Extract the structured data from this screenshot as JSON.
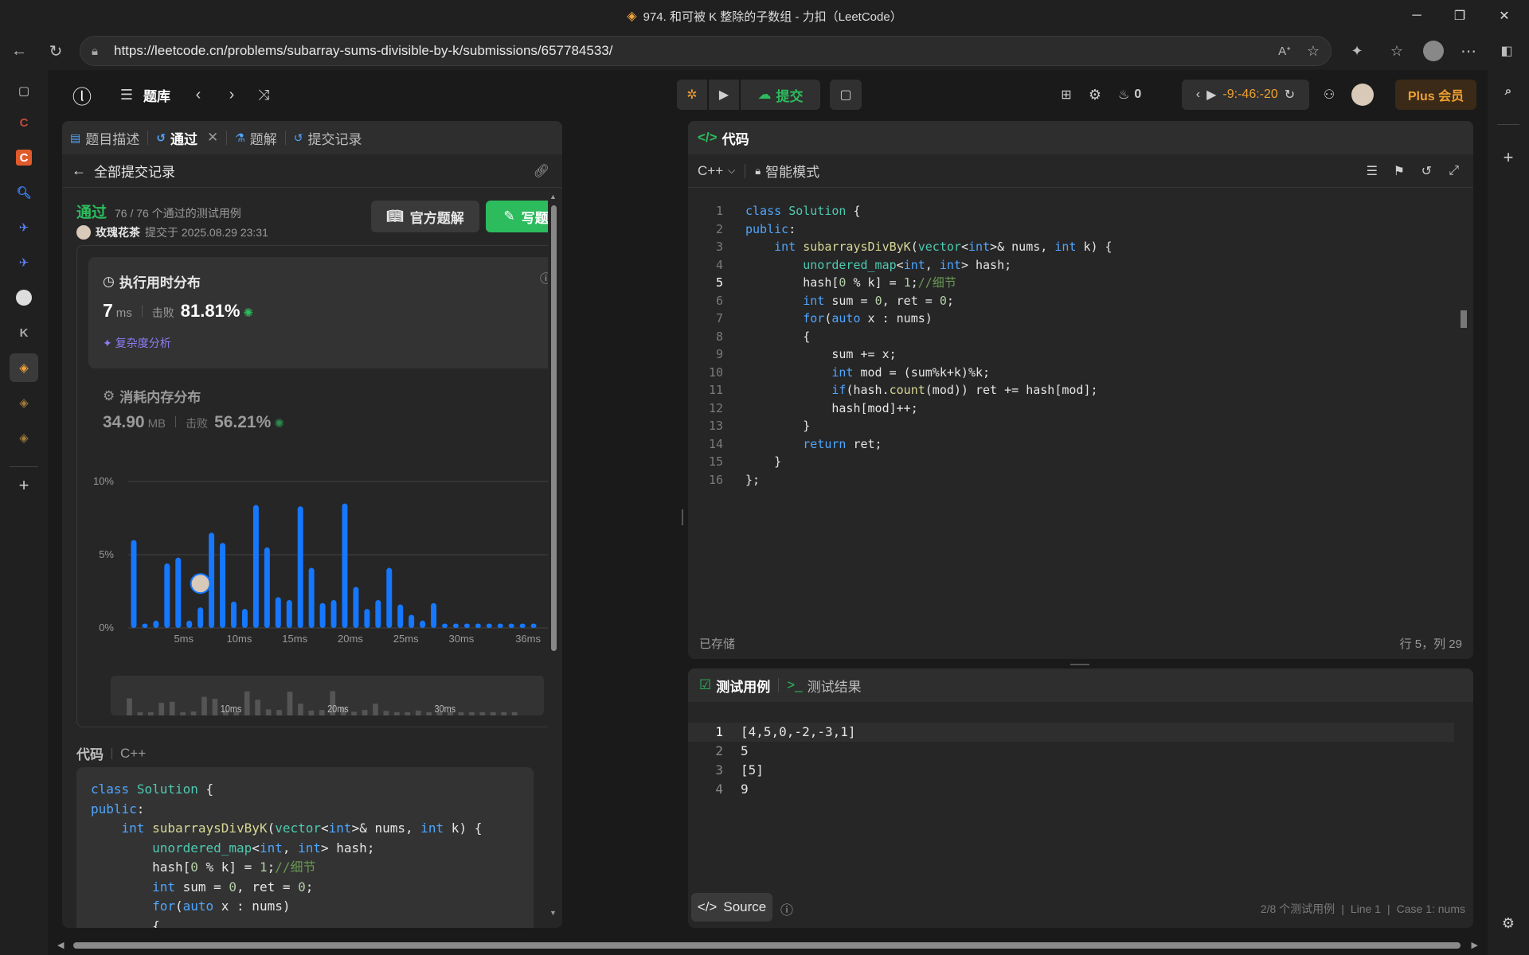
{
  "window": {
    "title": "974. 和可被 K 整除的子数组 - 力扣（LeetCode）"
  },
  "browser": {
    "url": "https://leetcode.cn/problems/subarray-sums-divisible-by-k/submissions/657784533/"
  },
  "topnav": {
    "problem_bank": "题库",
    "submit": "提交",
    "fire_count": "0",
    "timer": "-9:-46:-20",
    "plus": "Plus 会员"
  },
  "left": {
    "tabs": [
      "题目描述",
      "通过",
      "题解",
      "提交记录"
    ],
    "back_label": "全部提交记录",
    "status": "通过",
    "testcases": "76 / 76 个通过的测试用例",
    "user": "玫瑰花茶",
    "submitted_at": "提交于 2025.08.29 23:31",
    "official_solution": "官方题解",
    "write_solution": "写题解",
    "runtime": {
      "title": "执行用时分布",
      "value": "7",
      "unit": "ms",
      "beats_label": "击败",
      "beats": "81.81%",
      "analysis": "复杂度分析"
    },
    "memory": {
      "title": "消耗内存分布",
      "value": "34.90",
      "unit": "MB",
      "beats_label": "击败",
      "beats": "56.21%"
    },
    "code_label": "代码",
    "code_lang": "C++"
  },
  "chart_data": {
    "type": "bar",
    "y_ticks": [
      "10%",
      "5%",
      "0%"
    ],
    "x_ticks": [
      "5ms",
      "10ms",
      "15ms",
      "20ms",
      "25ms",
      "30ms",
      "36ms"
    ],
    "ylim": [
      0,
      10
    ],
    "bar_width_ms": 1,
    "user_runtime_ms": 7,
    "x": [
      1,
      2,
      3,
      4,
      5,
      6,
      7,
      8,
      9,
      10,
      11,
      12,
      13,
      14,
      15,
      16,
      17,
      18,
      19,
      20,
      21,
      22,
      23,
      24,
      25,
      26,
      27,
      28,
      29,
      30,
      31,
      32,
      33,
      34,
      35,
      36,
      37
    ],
    "values": [
      6.0,
      0.3,
      0.5,
      4.4,
      4.8,
      0.5,
      1.4,
      6.5,
      5.8,
      1.8,
      1.3,
      8.4,
      5.5,
      2.1,
      1.9,
      8.3,
      4.1,
      1.7,
      1.9,
      8.5,
      2.8,
      1.3,
      1.9,
      4.1,
      1.6,
      0.9,
      0.5,
      1.7,
      0.3,
      0.3,
      0.3,
      0.3,
      0.3,
      0.3,
      0.3,
      0.3,
      0.3
    ],
    "mini_ticks": [
      "10ms",
      "20ms",
      "30ms"
    ]
  },
  "code": {
    "header": "代码",
    "lang": "C++",
    "mode": "智能模式",
    "saved": "已存储",
    "cursor": "行 5，列 29",
    "lines": [
      "class Solution {",
      "public:",
      "    int subarraysDivByK(vector<int>& nums, int k) {",
      "        unordered_map<int, int> hash;",
      "        hash[0 % k] = 1;//细节",
      "        int sum = 0, ret = 0;",
      "        for(auto x : nums)",
      "        {",
      "            sum += x;",
      "            int mod = (sum%k+k)%k;",
      "            if(hash.count(mod)) ret += hash[mod];",
      "            hash[mod]++;",
      "        }",
      "        return ret;",
      "    }",
      "};"
    ]
  },
  "tests": {
    "tab1": "测试用例",
    "tab2": "测试结果",
    "lines": [
      "[4,5,0,-2,-3,1]",
      "5",
      "[5]",
      "9"
    ],
    "source": "Source",
    "status": "2/8 个测试用例",
    "line": "Line 1",
    "case": "Case 1: nums"
  }
}
